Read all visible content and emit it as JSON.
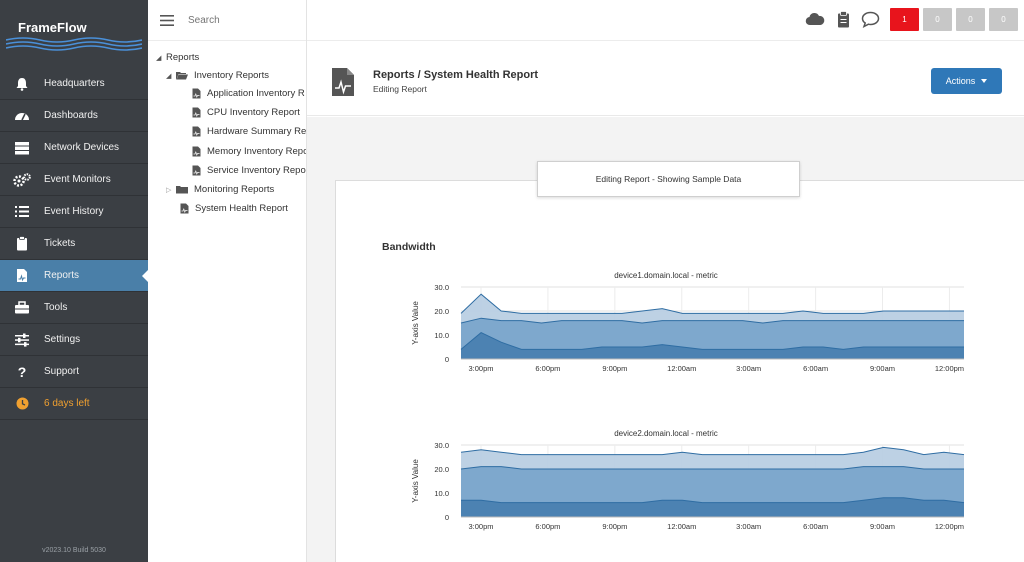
{
  "brand": {
    "name": "FrameFlow"
  },
  "nav": {
    "items": [
      {
        "label": "Headquarters",
        "icon": "bell-icon"
      },
      {
        "label": "Dashboards",
        "icon": "gauge-icon"
      },
      {
        "label": "Network Devices",
        "icon": "server-icon"
      },
      {
        "label": "Event Monitors",
        "icon": "gears-icon"
      },
      {
        "label": "Event History",
        "icon": "list-icon"
      },
      {
        "label": "Tickets",
        "icon": "clipboard-icon"
      },
      {
        "label": "Reports",
        "icon": "report-file-icon",
        "active": true
      },
      {
        "label": "Tools",
        "icon": "toolbox-icon"
      },
      {
        "label": "Settings",
        "icon": "sliders-icon"
      },
      {
        "label": "Support",
        "icon": "question-icon"
      }
    ],
    "trial": {
      "label": "6 days left",
      "icon": "clock-icon",
      "color": "#f0a030"
    },
    "version": "v2023.10 Build 5030"
  },
  "search": {
    "placeholder": "Search"
  },
  "tree": {
    "root": "Reports",
    "inventory": {
      "label": "Inventory Reports",
      "children": [
        "Application Inventory R",
        "CPU Inventory Report",
        "Hardware Summary Re",
        "Memory Inventory Repo",
        "Service Inventory Repo"
      ]
    },
    "monitoring": {
      "label": "Monitoring Reports"
    },
    "system_health": "System Health Report"
  },
  "topbar": {
    "icons": [
      "cloud-icon",
      "clipboard-icon",
      "chat-icon"
    ],
    "badges": [
      {
        "value": "1",
        "color": "#e8141c"
      },
      {
        "value": "0",
        "color": "#c7c7c7"
      },
      {
        "value": "0",
        "color": "#c7c7c7"
      },
      {
        "value": "0",
        "color": "#c7c7c7"
      }
    ]
  },
  "header": {
    "title": "Reports / System Health Report",
    "subtitle": "Editing Report",
    "actions_label": "Actions"
  },
  "notice": "Editing Report - Showing Sample Data",
  "section_title": "Bandwidth",
  "chart_data": [
    {
      "type": "area",
      "title": "device1.domain.local - metric",
      "ylabel": "Y-axis Value",
      "ylim": [
        0,
        30
      ],
      "yticks": [
        "0",
        "10.0",
        "20.0",
        "30.0"
      ],
      "xticks": [
        "3:00pm",
        "6:00pm",
        "9:00pm",
        "12:00am",
        "3:00am",
        "6:00am",
        "9:00am",
        "12:00pm"
      ],
      "colors": [
        "#b9cfe3",
        "#7aa5cb",
        "#4a7fb0"
      ],
      "series": [
        {
          "values": [
            19,
            27,
            20,
            19,
            19,
            19,
            19,
            19,
            19,
            20,
            21,
            19,
            19,
            19,
            19,
            19,
            19,
            20,
            19,
            19,
            19,
            20,
            20,
            20,
            20,
            20
          ]
        },
        {
          "values": [
            15,
            17,
            16,
            16,
            15,
            16,
            16,
            16,
            16,
            15,
            16,
            16,
            16,
            16,
            16,
            15,
            16,
            16,
            16,
            16,
            16,
            16,
            16,
            16,
            16,
            16
          ]
        },
        {
          "values": [
            4,
            11,
            7,
            4,
            4,
            4,
            4,
            5,
            5,
            5,
            6,
            5,
            4,
            4,
            4,
            4,
            4,
            5,
            5,
            4,
            5,
            5,
            5,
            5,
            5,
            5
          ]
        }
      ]
    },
    {
      "type": "area",
      "title": "device2.domain.local - metric",
      "ylabel": "Y-axis Value",
      "ylim": [
        0,
        30
      ],
      "yticks": [
        "0",
        "10.0",
        "20.0",
        "30.0"
      ],
      "xticks": [
        "3:00pm",
        "6:00pm",
        "9:00pm",
        "12:00am",
        "3:00am",
        "6:00am",
        "9:00am",
        "12:00pm"
      ],
      "colors": [
        "#b9cfe3",
        "#7aa5cb",
        "#4a7fb0"
      ],
      "series": [
        {
          "values": [
            27,
            28,
            27,
            26,
            26,
            26,
            26,
            26,
            26,
            26,
            26,
            27,
            26,
            26,
            26,
            26,
            26,
            26,
            26,
            26,
            27,
            29,
            28,
            26,
            27,
            26
          ]
        },
        {
          "values": [
            20,
            21,
            21,
            20,
            20,
            20,
            20,
            20,
            20,
            20,
            20,
            20,
            20,
            20,
            20,
            20,
            20,
            20,
            20,
            20,
            21,
            21,
            21,
            20,
            20,
            20
          ]
        },
        {
          "values": [
            7,
            7,
            6,
            6,
            6,
            6,
            6,
            6,
            6,
            6,
            7,
            7,
            6,
            6,
            6,
            6,
            6,
            6,
            6,
            6,
            7,
            8,
            8,
            7,
            7,
            6
          ]
        }
      ]
    }
  ]
}
